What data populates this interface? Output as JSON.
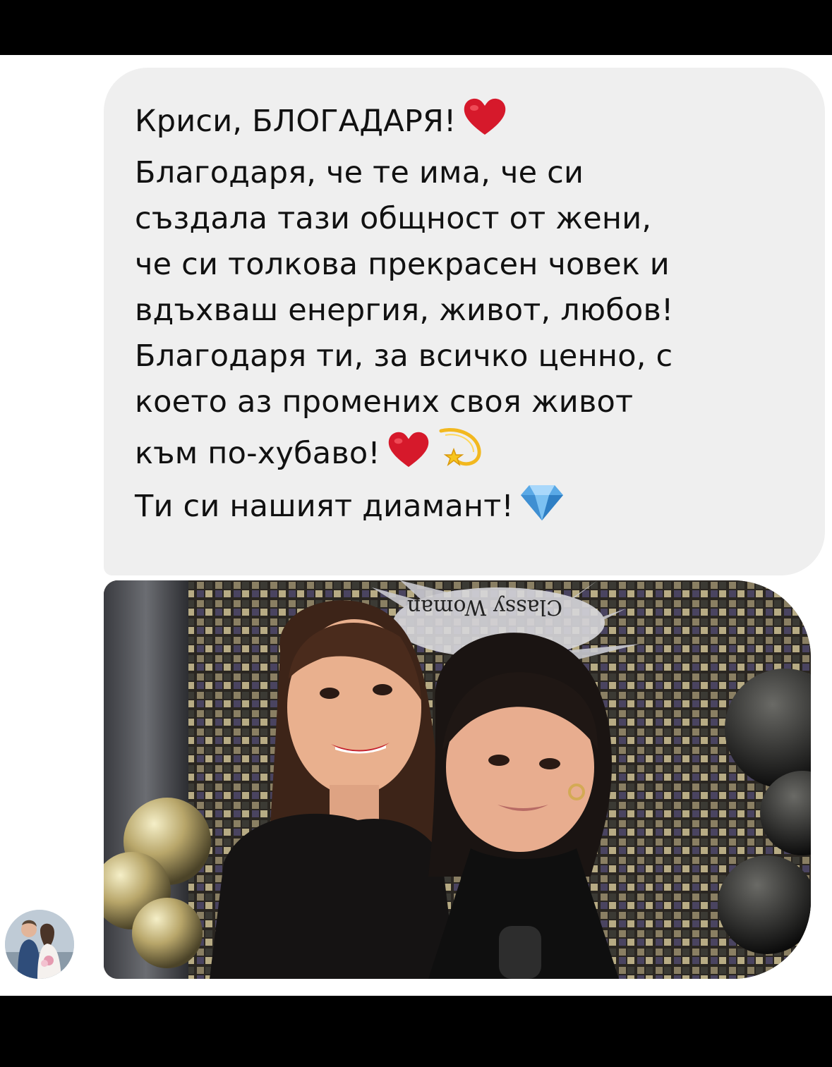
{
  "message": {
    "lines": [
      "Криси, БЛОГАДАРЯ!",
      "Благодаря, че те има, че си",
      "създала тази общност от жени,",
      "че си толкова прекрасен човек и",
      "вдъхваш енергия,  живот, любов!",
      "Благодаря ти, за всичко ценно, с",
      "което аз промених своя живот",
      "към по-хубаво!",
      "Ти си нашият диамант!"
    ],
    "emojis": {
      "line_1": [
        "heart-icon"
      ],
      "line_8": [
        "heart-icon",
        "dizzy-star-icon"
      ],
      "line_9": [
        "gem-icon"
      ]
    }
  },
  "photo": {
    "banner_text": "Classy Woman",
    "subject": "two women selfie at event"
  },
  "colors": {
    "bubble": "#efefef",
    "text": "#111111",
    "heart": "#d6192b",
    "gem": "#5aa9e6",
    "frame": "#000000"
  }
}
